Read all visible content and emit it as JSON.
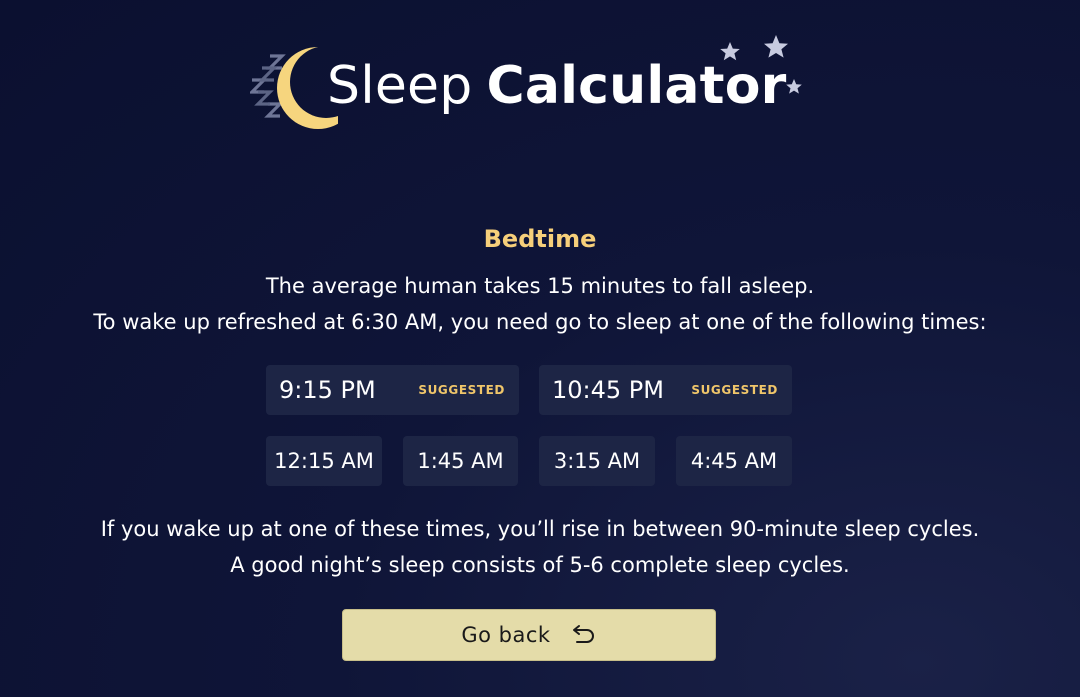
{
  "app": {
    "title_light": "Sleep",
    "title_bold": "Calculator"
  },
  "bedtime": {
    "heading": "Bedtime",
    "intro_line1": "The average human takes 15 minutes to fall asleep.",
    "intro_line2": "To wake up refreshed at 6:30 AM, you need go to sleep at one of the following times:",
    "suggested": [
      {
        "time": "9:15 PM",
        "badge": "SUGGESTED"
      },
      {
        "time": "10:45 PM",
        "badge": "SUGGESTED"
      }
    ],
    "other_times": [
      "12:15 AM",
      "1:45 AM",
      "3:15 AM",
      "4:45 AM"
    ],
    "outro_line1": "If you wake up at one of these times, you’ll rise in between 90-minute sleep cycles.",
    "outro_line2": "A good night’s sleep consists of 5-6 complete sleep cycles."
  },
  "actions": {
    "go_back_label": "Go back",
    "go_back_icon": "undo-arrow-icon"
  },
  "colors": {
    "background": "#0f1538",
    "accent_gold": "#f6cf7a",
    "button_bg": "#1d2545",
    "back_button_bg": "#e4dca9",
    "moon": "#f6d57e",
    "zzz": "#6e7596",
    "stars": "#c8cbe0"
  },
  "icons": {
    "logo_moon": "crescent-moon-icon",
    "logo_zzz": "sleep-zzz-icon",
    "logo_stars": "stars-icon"
  }
}
